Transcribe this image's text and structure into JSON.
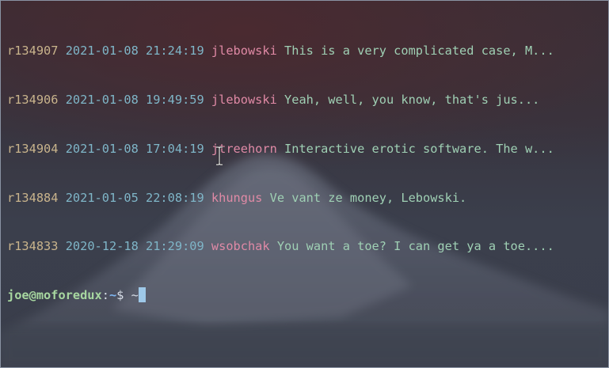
{
  "log_entries": [
    {
      "revision": "r134907",
      "date": "2021-01-08",
      "time": "21:24:19",
      "author": "jlebowski",
      "message": "This is a very complicated case, M..."
    },
    {
      "revision": "r134906",
      "date": "2021-01-08",
      "time": "19:49:59",
      "author": "jlebowski",
      "message": "Yeah, well, you know, that's jus..."
    },
    {
      "revision": "r134904",
      "date": "2021-01-08",
      "time": "17:04:19",
      "author": "jtreehorn",
      "message": "Interactive erotic software. The w..."
    },
    {
      "revision": "r134884",
      "date": "2021-01-05",
      "time": "22:08:19",
      "author": "khungus",
      "message": "Ve vant ze money, Lebowski."
    },
    {
      "revision": "r134833",
      "date": "2020-12-18",
      "time": "21:29:09",
      "author": "wsobchak",
      "message": "You want a toe? I can get ya a toe...."
    }
  ],
  "prompt": {
    "user_host": "joe@moforedux",
    "colon": ":",
    "path": "~",
    "symbol": "$",
    "input": "~"
  },
  "colors": {
    "revision": "#c9b48c",
    "date": "#7fb6c8",
    "author": "#e08aa6",
    "message": "#9fd0b4",
    "prompt_user": "#a7d7a0",
    "prompt_path": "#7fb6f0",
    "cursor": "#9ec8e8"
  },
  "icons": {
    "mouse_pointer": "text-ibeam-cursor-icon"
  }
}
